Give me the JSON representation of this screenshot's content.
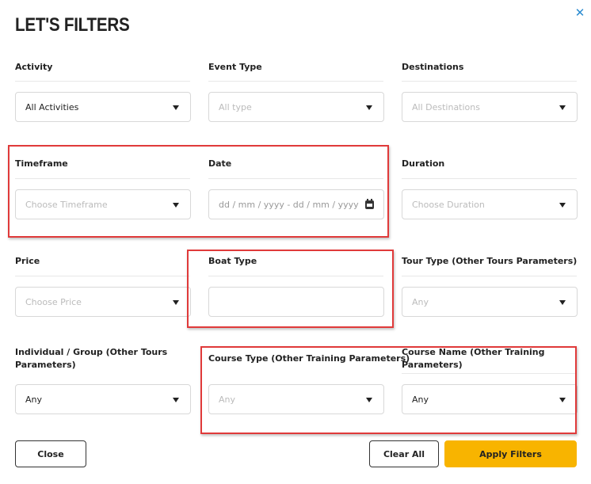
{
  "dialog": {
    "title": "LET'S FILTERS",
    "close_icon": "✕"
  },
  "filters": {
    "activity": {
      "label": "Activity",
      "value": "All Activities"
    },
    "event_type": {
      "label": "Event Type",
      "placeholder": "All type"
    },
    "destinations": {
      "label": "Destinations",
      "placeholder": "All Destinations"
    },
    "timeframe": {
      "label": "Timeframe",
      "placeholder": "Choose Timeframe"
    },
    "date": {
      "label": "Date",
      "placeholder": "dd / mm / yyyy - dd / mm / yyyy"
    },
    "duration": {
      "label": "Duration",
      "placeholder": "Choose Duration"
    },
    "price": {
      "label": "Price",
      "placeholder": "Choose Price"
    },
    "boat_type": {
      "label": "Boat Type",
      "value": ""
    },
    "tour_type": {
      "label": "Tour Type (Other Tours Parameters)",
      "placeholder": "Any"
    },
    "individual_group": {
      "label": "Individual / Group (Other Tours Parameters)",
      "value": "Any"
    },
    "course_type": {
      "label": "Course Type (Other Training Parameters)",
      "placeholder": "Any"
    },
    "course_name": {
      "label": "Course Name (Other Training Parameters)",
      "value": "Any"
    }
  },
  "footer": {
    "close_label": "Close",
    "clear_all_label": "Clear All",
    "apply_label": "Apply Filters"
  },
  "colors": {
    "accent": "#f8b400",
    "highlight": "#e03a3a",
    "close_icon": "#2a8bd0"
  },
  "icons": {
    "dropdown": "caret-down-icon",
    "date": "calendar-icon",
    "close": "close-icon"
  }
}
